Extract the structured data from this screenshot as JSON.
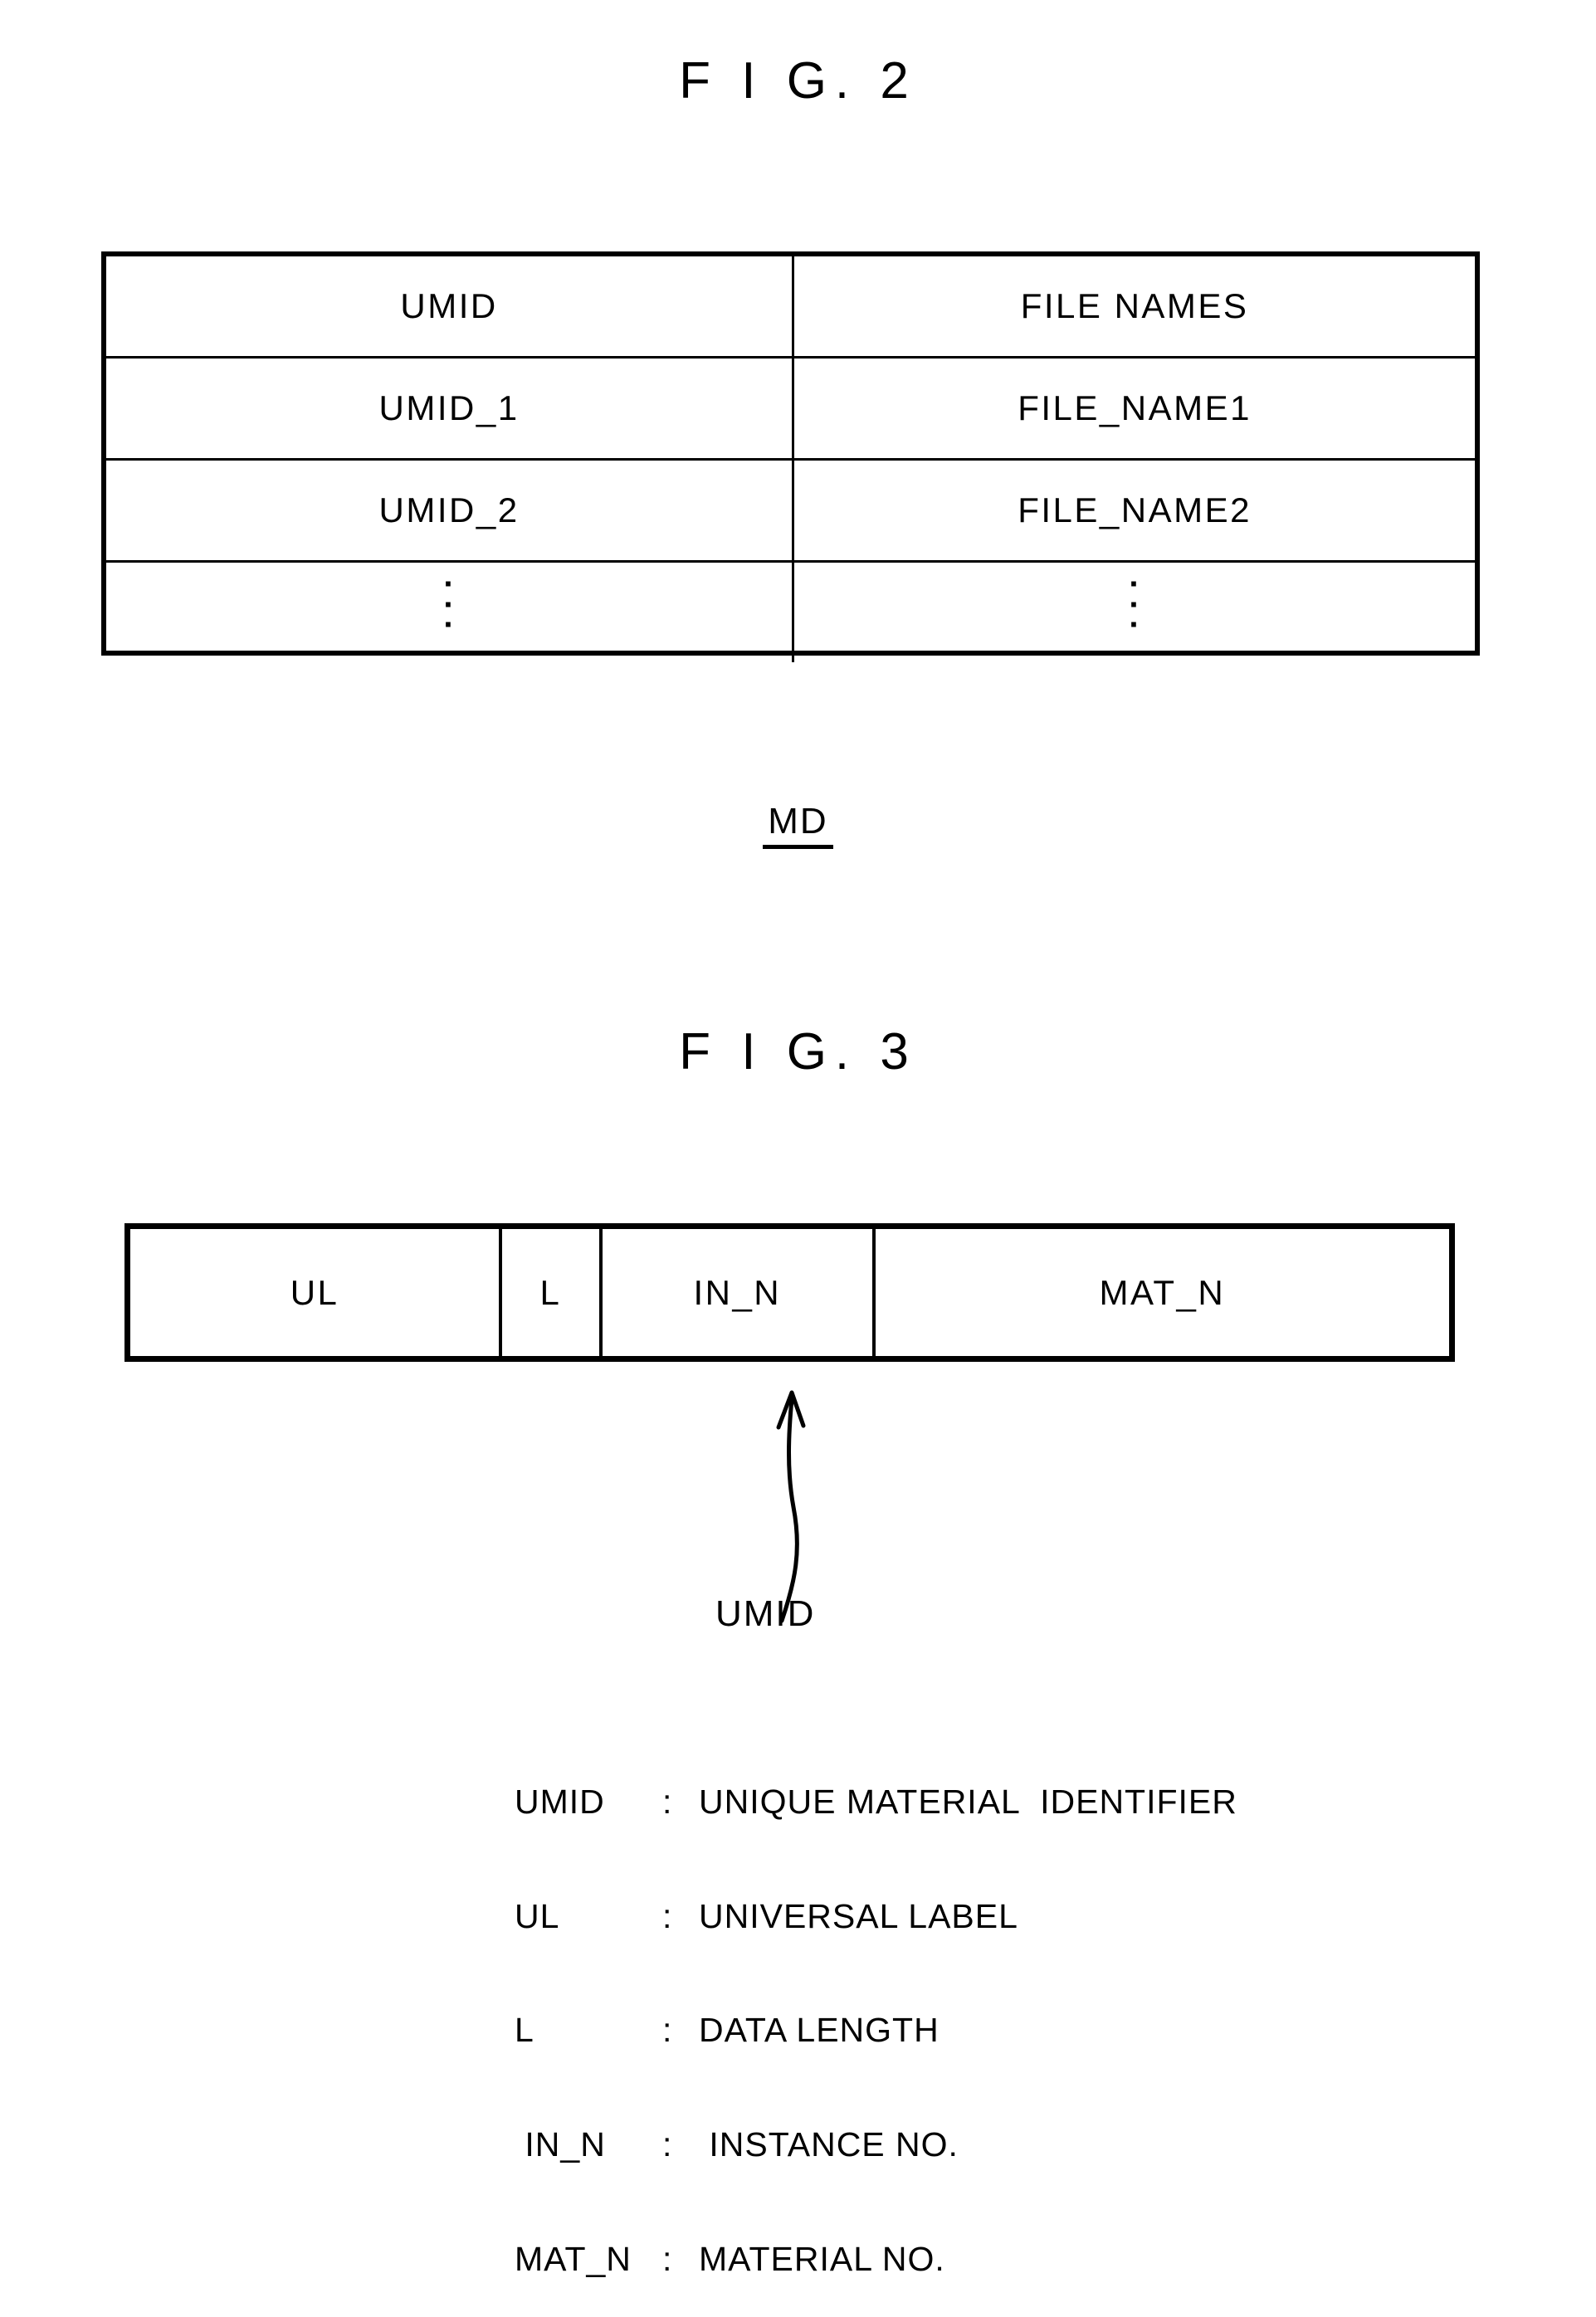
{
  "figures": [
    {
      "title": "F I G. 2",
      "table": {
        "headers": [
          "UMID",
          "FILE NAMES"
        ],
        "rows": [
          [
            "UMID_1",
            "FILE_NAME1"
          ],
          [
            "UMID_2",
            "FILE_NAME2"
          ],
          [
            "⋮",
            "⋮"
          ]
        ]
      },
      "caption": "MD"
    },
    {
      "title": "F I G. 3",
      "bar_segments": [
        {
          "label": "UL"
        },
        {
          "label": "L"
        },
        {
          "label": "IN_N"
        },
        {
          "label": "MAT_N"
        }
      ],
      "callout": "UMID",
      "legend": [
        {
          "term": "UMID",
          "colon": ":",
          "desc": "UNIQUE MATERIAL  IDENTIFIER"
        },
        {
          "term": "UL",
          "colon": ":",
          "desc": "UNIVERSAL LABEL"
        },
        {
          "term": "L",
          "colon": ":",
          "desc": "DATA LENGTH"
        },
        {
          "term": " IN_N",
          "colon": ":",
          "desc": " INSTANCE NO."
        },
        {
          "term": "MAT_N",
          "colon": ":",
          "desc": "MATERIAL NO."
        }
      ]
    }
  ],
  "dots_glyph": "·",
  "colors": {
    "ink": "#000000",
    "paper": "#ffffff"
  }
}
